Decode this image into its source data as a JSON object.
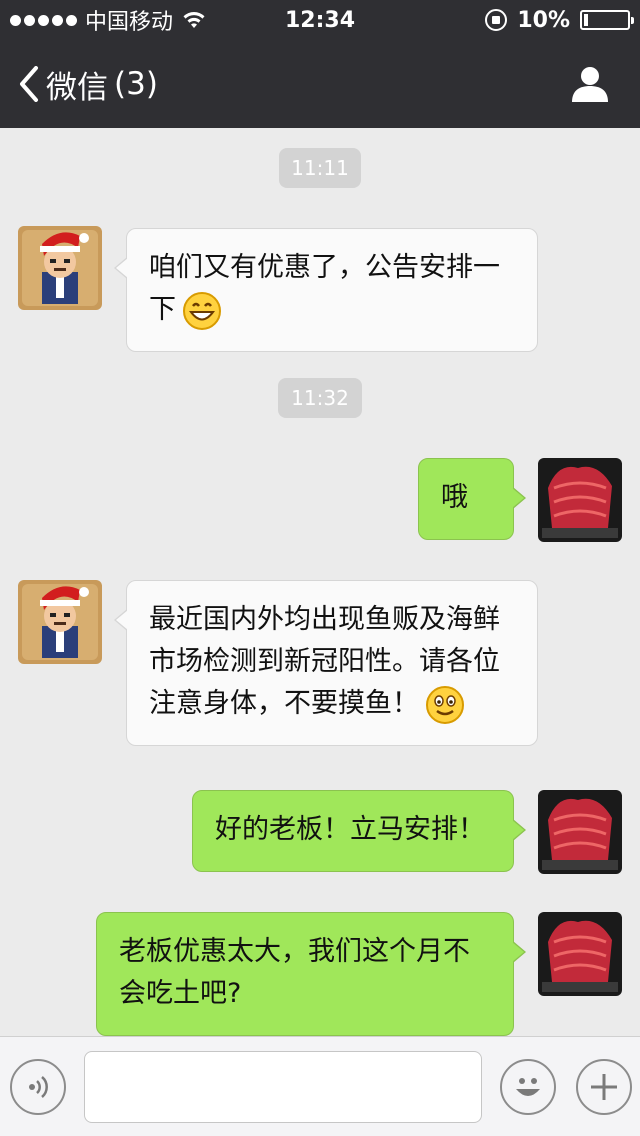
{
  "status_bar": {
    "carrier": "中国移动",
    "time": "12:34",
    "battery_percent": "10%",
    "battery_level": 0.1,
    "signal_icon": "signal-dots-icon",
    "wifi_icon": "wifi-icon",
    "rotation_lock_icon": "rotation-lock-icon"
  },
  "nav": {
    "back_label": "微信",
    "unread_count": "(3)",
    "back_icon": "chevron-left-icon",
    "profile_icon": "person-icon"
  },
  "chat": {
    "timestamps": [
      "11:11",
      "11:32"
    ],
    "messages": [
      {
        "side": "in",
        "text": "咱们又有优惠了，公告安排一下",
        "emoji": "grin-emoji-icon"
      },
      {
        "side": "out",
        "text": "哦"
      },
      {
        "side": "in",
        "text": "最近国内外均出现鱼贩及海鲜市场检测到新冠阳性。请各位注意身体，不要摸鱼！",
        "emoji": "smile-emoji-icon"
      },
      {
        "side": "out",
        "text": "好的老板！立马安排！"
      },
      {
        "side": "out",
        "text": "老板优惠太大，我们这个月不会吃土吧?"
      }
    ]
  },
  "input_bar": {
    "voice_icon": "voice-icon",
    "input_placeholder": "",
    "emoji_icon": "emoji-face-icon",
    "plus_icon": "plus-icon"
  },
  "colors": {
    "header_bg": "#2f2f33",
    "chat_bg": "#ebebeb",
    "outgoing_bubble": "#a0e75a",
    "incoming_bubble": "#fafafa",
    "timestamp_pill": "#d3d3d3"
  }
}
